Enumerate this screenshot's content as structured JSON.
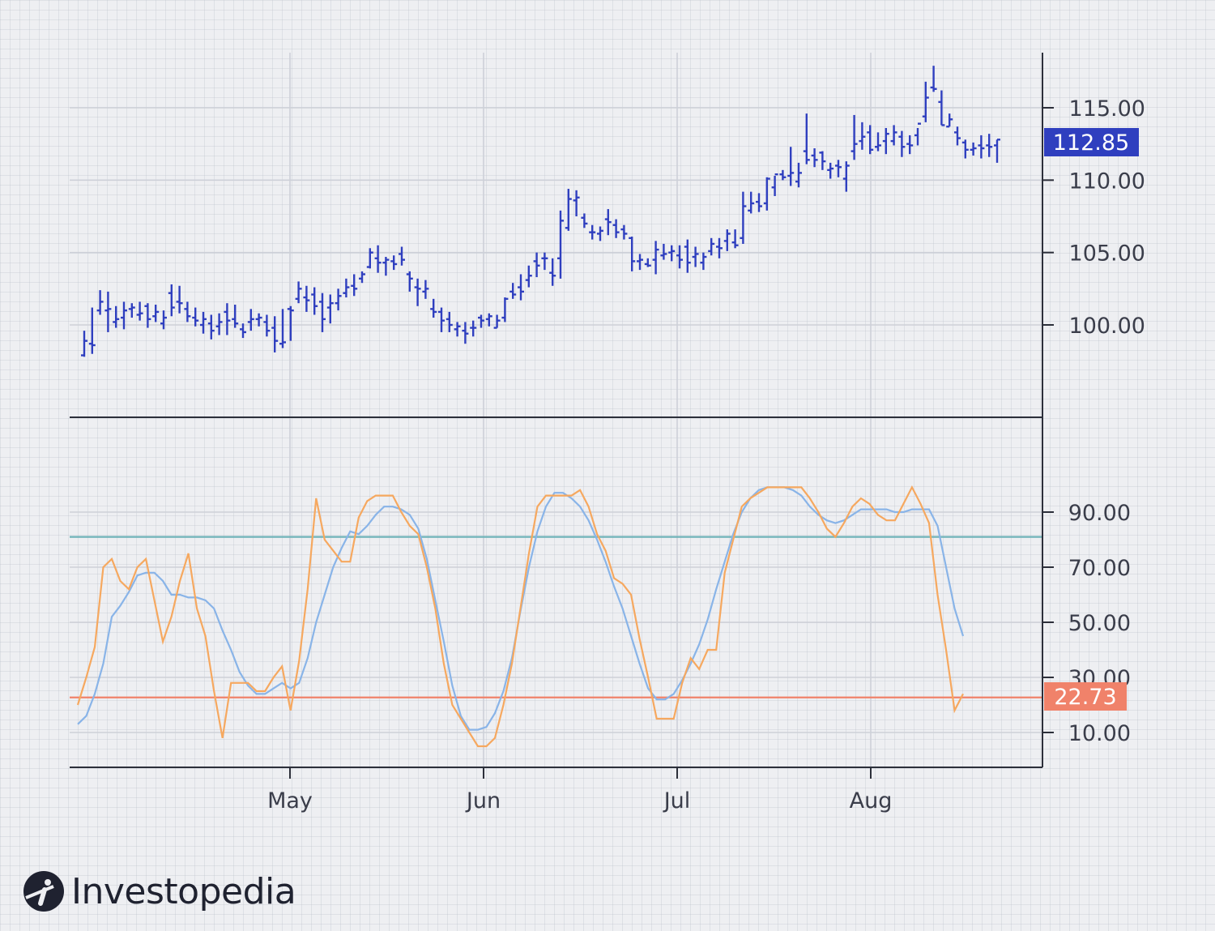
{
  "logo": {
    "text": "Investopedia"
  },
  "colors": {
    "price_bars": "#2f3fbf",
    "stoch_k": "#f6a85f",
    "stoch_d": "#89b4e8",
    "overbought_line": "#6fb3b8",
    "oversold_line": "#f0826a",
    "axis": "#2c2f3a",
    "grid": "#cdd0d8"
  },
  "chart_data": [
    {
      "type": "ohlc",
      "panel": "price",
      "ylim": [
        93.5,
        118.5
      ],
      "y_ticks": [
        "100.00",
        "105.00",
        "110.00",
        "115.00"
      ],
      "last_price_label": "112.85",
      "x_labels": [
        "May",
        "Jun",
        "Jul",
        "Aug"
      ],
      "bars": [
        [
          97.9,
          99.6,
          97.8,
          98.9
        ],
        [
          98.7,
          101.2,
          98.0,
          98.6
        ],
        [
          101.0,
          102.4,
          100.7,
          101.6
        ],
        [
          101.0,
          102.3,
          99.5,
          101.1
        ],
        [
          100.2,
          101.3,
          99.8,
          100.4
        ],
        [
          100.5,
          101.6,
          99.7,
          101.0
        ],
        [
          101.1,
          101.5,
          100.5,
          101.2
        ],
        [
          100.7,
          101.6,
          100.3,
          100.8
        ],
        [
          101.3,
          101.5,
          99.8,
          100.4
        ],
        [
          100.6,
          101.4,
          100.2,
          100.9
        ],
        [
          100.1,
          101.0,
          99.7,
          100.5
        ],
        [
          102.2,
          102.8,
          100.6,
          101.2
        ],
        [
          101.6,
          102.7,
          100.8,
          101.5
        ],
        [
          101.1,
          101.6,
          100.2,
          100.6
        ],
        [
          100.5,
          101.2,
          99.9,
          100.3
        ],
        [
          100.0,
          100.9,
          99.4,
          100.4
        ],
        [
          100.1,
          100.7,
          99.0,
          99.6
        ],
        [
          99.9,
          100.8,
          99.3,
          100.2
        ],
        [
          100.9,
          101.5,
          99.3,
          100.3
        ],
        [
          100.4,
          101.4,
          99.8,
          100.1
        ],
        [
          99.7,
          100.1,
          99.1,
          99.5
        ],
        [
          100.2,
          101.1,
          99.6,
          100.4
        ],
        [
          100.4,
          100.8,
          99.9,
          100.5
        ],
        [
          100.2,
          100.7,
          99.2,
          99.6
        ],
        [
          99.8,
          100.6,
          98.1,
          98.9
        ],
        [
          98.7,
          101.1,
          98.4,
          98.8
        ],
        [
          101.1,
          101.3,
          98.9,
          101.0
        ],
        [
          101.8,
          103.0,
          101.5,
          102.5
        ],
        [
          101.9,
          102.7,
          100.9,
          101.7
        ],
        [
          102.1,
          102.6,
          100.7,
          101.3
        ],
        [
          101.6,
          102.2,
          99.5,
          100.4
        ],
        [
          101.2,
          102.1,
          100.1,
          101.5
        ],
        [
          101.5,
          102.5,
          101.0,
          102.0
        ],
        [
          102.2,
          103.2,
          101.9,
          102.6
        ],
        [
          102.7,
          103.5,
          102.0,
          102.5
        ],
        [
          103.2,
          103.7,
          102.9,
          103.5
        ],
        [
          104.0,
          105.3,
          103.9,
          105.0
        ],
        [
          104.6,
          105.5,
          103.6,
          104.3
        ],
        [
          104.3,
          104.7,
          103.4,
          104.5
        ],
        [
          104.4,
          104.8,
          103.8,
          104.2
        ],
        [
          104.9,
          105.4,
          104.1,
          104.5
        ],
        [
          103.5,
          103.7,
          102.3,
          103.2
        ],
        [
          102.6,
          103.2,
          101.3,
          102.5
        ],
        [
          102.3,
          103.1,
          101.8,
          102.5
        ],
        [
          101.1,
          101.8,
          100.5,
          100.9
        ],
        [
          100.9,
          101.2,
          99.5,
          100.3
        ],
        [
          100.4,
          100.9,
          99.5,
          100.0
        ],
        [
          99.7,
          100.2,
          99.2,
          99.9
        ],
        [
          99.6,
          100.2,
          98.7,
          99.4
        ],
        [
          99.8,
          100.3,
          99.2,
          99.8
        ],
        [
          100.5,
          100.7,
          99.8,
          100.3
        ],
        [
          100.4,
          100.8,
          99.9,
          100.6
        ],
        [
          99.8,
          100.7,
          99.8,
          100.3
        ],
        [
          100.5,
          101.9,
          100.2,
          101.8
        ],
        [
          102.3,
          102.9,
          101.8,
          102.1
        ],
        [
          102.6,
          103.5,
          101.7,
          102.3
        ],
        [
          103.1,
          104.1,
          102.6,
          103.4
        ],
        [
          104.4,
          105.0,
          103.3,
          104.1
        ],
        [
          104.6,
          105.0,
          103.8,
          104.6
        ],
        [
          103.6,
          104.6,
          102.7,
          103.4
        ],
        [
          104.6,
          107.9,
          103.2,
          107.2
        ],
        [
          106.7,
          109.4,
          106.5,
          108.7
        ],
        [
          108.6,
          109.3,
          107.5,
          108.8
        ],
        [
          107.4,
          107.7,
          106.7,
          107.0
        ],
        [
          106.4,
          106.9,
          105.9,
          106.4
        ],
        [
          106.3,
          106.8,
          105.8,
          106.5
        ],
        [
          107.3,
          108.0,
          106.2,
          107.1
        ],
        [
          106.9,
          107.3,
          106.0,
          106.4
        ],
        [
          106.6,
          106.9,
          105.9,
          106.3
        ],
        [
          106.0,
          106.1,
          103.7,
          104.4
        ],
        [
          104.4,
          104.9,
          103.8,
          104.5
        ],
        [
          104.2,
          104.6,
          104.0,
          104.1
        ],
        [
          104.5,
          105.8,
          103.5,
          105.2
        ],
        [
          104.8,
          105.6,
          104.5,
          104.9
        ],
        [
          105.0,
          105.5,
          104.4,
          105.1
        ],
        [
          104.8,
          105.5,
          103.9,
          104.5
        ],
        [
          105.4,
          105.9,
          103.6,
          104.3
        ],
        [
          104.7,
          105.4,
          104.0,
          104.9
        ],
        [
          104.3,
          105.0,
          103.8,
          104.7
        ],
        [
          105.1,
          106.0,
          104.8,
          105.6
        ],
        [
          105.4,
          106.0,
          104.6,
          105.3
        ],
        [
          105.8,
          106.6,
          105.1,
          106.3
        ],
        [
          105.7,
          106.6,
          105.3,
          105.5
        ],
        [
          106.0,
          109.2,
          105.6,
          108.2
        ],
        [
          107.9,
          109.2,
          107.7,
          108.4
        ],
        [
          108.5,
          109.1,
          107.8,
          108.2
        ],
        [
          108.4,
          110.2,
          107.9,
          110.1
        ],
        [
          109.5,
          110.3,
          108.9,
          110.4
        ],
        [
          110.4,
          110.7,
          110.0,
          110.2
        ],
        [
          110.3,
          112.3,
          109.6,
          110.5
        ],
        [
          109.9,
          111.2,
          109.5,
          110.5
        ],
        [
          112.0,
          114.6,
          111.1,
          111.4
        ],
        [
          111.7,
          112.2,
          110.9,
          111.4
        ],
        [
          111.9,
          112.0,
          110.7,
          111.3
        ],
        [
          110.7,
          111.2,
          110.1,
          110.8
        ],
        [
          111.0,
          111.4,
          110.2,
          110.9
        ],
        [
          110.1,
          111.3,
          109.2,
          111.0
        ],
        [
          112.0,
          114.5,
          111.4,
          112.5
        ],
        [
          112.7,
          114.0,
          112.1,
          113.0
        ],
        [
          113.3,
          113.8,
          111.8,
          112.1
        ],
        [
          112.3,
          113.3,
          112.0,
          112.4
        ],
        [
          112.7,
          113.6,
          111.8,
          113.2
        ],
        [
          112.7,
          113.8,
          112.4,
          113.3
        ],
        [
          113.0,
          113.4,
          111.6,
          112.3
        ],
        [
          112.5,
          113.1,
          111.8,
          112.4
        ],
        [
          113.1,
          113.6,
          112.4,
          113.9
        ],
        [
          114.4,
          116.8,
          114.0,
          115.7
        ],
        [
          116.4,
          117.9,
          116.1,
          116.3
        ],
        [
          115.4,
          116.2,
          113.8,
          113.8
        ],
        [
          113.7,
          114.6,
          113.7,
          114.2
        ],
        [
          113.3,
          113.7,
          112.4,
          112.9
        ],
        [
          112.6,
          112.8,
          111.5,
          112.1
        ],
        [
          112.1,
          112.6,
          111.7,
          112.2
        ],
        [
          112.4,
          113.1,
          111.5,
          112.2
        ],
        [
          112.4,
          113.2,
          111.6,
          112.3
        ],
        [
          112.4,
          112.8,
          111.2,
          112.8
        ]
      ]
    },
    {
      "type": "line",
      "panel": "stochastic",
      "ylim": [
        -3,
        105
      ],
      "y_ticks": [
        "10.00",
        "30.00",
        "50.00",
        "70.00",
        "90.00"
      ],
      "hlines": [
        81,
        22.73
      ],
      "oversold_label": "22.73",
      "series": [
        {
          "values": [
            20,
            30,
            41,
            70,
            73,
            65,
            62,
            70,
            73,
            58,
            43,
            52,
            65,
            75,
            55,
            45,
            25,
            8,
            28,
            28,
            28,
            25,
            25,
            30,
            34,
            18,
            36,
            62,
            95,
            80,
            76,
            72,
            72,
            88,
            94,
            96,
            96,
            96,
            90,
            85,
            82,
            70,
            55,
            35,
            20,
            15,
            10,
            5,
            5,
            8,
            20,
            35,
            55,
            75,
            92,
            96,
            96,
            96,
            96,
            98,
            92,
            82,
            76,
            66,
            64,
            60,
            44,
            30,
            15,
            15,
            15,
            28,
            37,
            33,
            40,
            40,
            68,
            80,
            92,
            95,
            97,
            99,
            99,
            99,
            99,
            99,
            95,
            90,
            84,
            81,
            86,
            92,
            95,
            93,
            89,
            87,
            87,
            93,
            99,
            93,
            86,
            60,
            40,
            18,
            24
          ]
        },
        {
          "values": [
            13,
            16,
            24,
            35,
            52,
            56,
            61,
            67,
            68,
            68,
            65,
            60,
            60,
            59,
            59,
            58,
            55,
            47,
            40,
            32,
            27,
            24,
            24,
            26,
            28,
            26,
            28,
            37,
            50,
            60,
            70,
            77,
            83,
            82,
            85,
            89,
            92,
            92,
            91,
            89,
            84,
            73,
            58,
            43,
            27,
            16,
            11,
            11,
            12,
            17,
            25,
            37,
            54,
            70,
            83,
            92,
            97,
            97,
            95,
            92,
            87,
            80,
            72,
            63,
            55,
            45,
            35,
            26,
            22,
            22,
            24,
            29,
            35,
            42,
            51,
            62,
            72,
            82,
            90,
            95,
            98,
            99,
            99,
            99,
            98,
            96,
            92,
            89,
            87,
            86,
            87,
            89,
            91,
            91,
            91,
            91,
            90,
            90,
            91,
            91,
            91,
            85,
            70,
            55,
            45
          ]
        }
      ]
    }
  ]
}
